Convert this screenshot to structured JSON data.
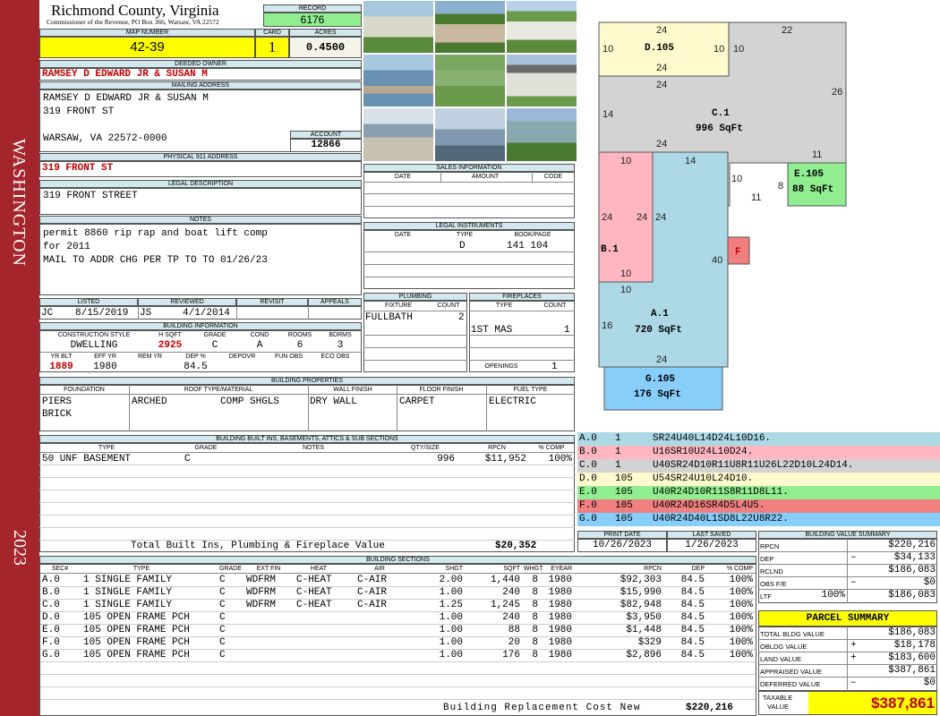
{
  "sidebar": {
    "district": "WASHINGTON",
    "year": "2023"
  },
  "header": {
    "county": "Richmond County, Virginia",
    "commissioner": "Commissioner of the Revenue, PO Box 366, Warsaw, VA 22572",
    "record_label": "RECORD",
    "record": "6176",
    "map_label": "MAP NUMBER",
    "map_number": "42-39",
    "card_label": "CARD",
    "card": "1",
    "acres_label": "ACRES",
    "acres": "0.4500"
  },
  "owner": {
    "deeded_label": "DEEDED OWNER",
    "deeded": "RAMSEY D EDWARD JR & SUSAN M",
    "mailing_label": "MAILING ADDRESS",
    "mail1": "RAMSEY D EDWARD JR & SUSAN M",
    "mail2": "319 FRONT ST",
    "mail3": "WARSAW, VA 22572-0000",
    "account_label": "ACCOUNT",
    "account": "12866",
    "physical_label": "PHYSICAL 911 ADDRESS",
    "physical": "319 FRONT ST",
    "legal_label": "LEGAL DESCRIPTION",
    "legal": "319 FRONT STREET",
    "notes_label": "NOTES",
    "notes1": "permit 8860 rip rap and boat lift comp",
    "notes2": "for 2011",
    "notes3": "MAIL TO ADDR CHG PER TP TO TO 01/26/23"
  },
  "review": {
    "listed_label": "LISTED",
    "reviewed_label": "REVIEWED",
    "revisit_label": "REVISIT",
    "appeals_label": "APPEALS",
    "listed_by": "JC",
    "listed_date": "8/15/2019",
    "reviewed_by": "JS",
    "reviewed_date": "4/1/2014"
  },
  "building_info": {
    "label": "BUILDING INFORMATION",
    "h_style": "CONSTRUCTION STYLE",
    "h_hsqft": "H SQFT",
    "h_grade": "GRADE",
    "h_cond": "COND",
    "h_rooms": "ROOMS",
    "h_bdrms": "BDRMS",
    "style": "DWELLING",
    "hsqft": "2925",
    "grade": "C",
    "cond": "A",
    "rooms": "6",
    "bdrms": "3",
    "h_yrblt": "YR BLT",
    "h_effyr": "EFF YR",
    "h_remyr": "REM YR",
    "h_dep": "DEP %",
    "h_depovr": "DEPOVR",
    "h_funobs": "FUN OBS",
    "h_ecoobs": "ECO OBS",
    "yrblt": "1889",
    "effyr": "1980",
    "dep": "84.5"
  },
  "sales": {
    "label": "SALES INFORMATION",
    "date": "DATE",
    "amount": "AMOUNT",
    "code": "CODE"
  },
  "legal_inst": {
    "label": "LEGAL INSTRUMENTS",
    "date": "DATE",
    "type": "TYPE",
    "bookpage": "BOOK/PAGE",
    "row_type": "D",
    "row_book": "141 104"
  },
  "plumbing": {
    "label": "PLUMBING",
    "fixture": "FIXTURE",
    "count": "COUNT",
    "row_fixture": "FULLBATH",
    "row_count": "2"
  },
  "fireplaces": {
    "label": "FIREPLACES",
    "type": "TYPE",
    "count": "COUNT",
    "row_type": "1ST MAS",
    "row_count": "1",
    "openings_label": "OPENINGS",
    "openings": "1"
  },
  "properties": {
    "label": "BUILDING PROPERTIES",
    "foundation_label": "FOUNDATION",
    "roof_label": "ROOF TYPE/MATERIAL",
    "wall_label": "WALL FINISH",
    "floor_label": "FLOOR FINISH",
    "fuel_label": "FUEL TYPE",
    "foundation1": "PIERS",
    "foundation2": "BRICK",
    "roof1": "ARCHED",
    "roof2": "COMP SHGLS",
    "wall": "DRY WALL",
    "floor": "CARPET",
    "fuel": "ELECTRIC"
  },
  "builtins": {
    "label": "BUILDING BUILT INS, BASEMENTS, ATTICS & SUB SECTIONS",
    "h_type": "TYPE",
    "h_grade": "GRADE",
    "h_notes": "NOTES",
    "h_qty": "QTY/SIZE",
    "h_rpcn": "RPCN",
    "h_comp": "% COMP",
    "row_type": "50 UNF BASEMENT",
    "row_grade": "C",
    "row_qty": "996",
    "row_rpcn": "$11,952",
    "row_comp": "100%",
    "total_label": "Total Built Ins, Plumbing & Fireplace Value",
    "total": "$20,352"
  },
  "sketch_labels": {
    "d105_name": "D.105",
    "c1_name": "C.1",
    "c1_area": "996 SqFt",
    "e105_name": "E.105",
    "e105_area": "88 SqFt",
    "b1_name": "B.1",
    "f_name": "F",
    "a1_name": "A.1",
    "a1_area": "720 SqFt",
    "g105_name": "G.105",
    "g105_area": "176 SqFt",
    "dims": [
      "24",
      "10",
      "10",
      "10",
      "22",
      "24",
      "24",
      "26",
      "14",
      "24",
      "11",
      "10",
      "14",
      "10",
      "8",
      "11",
      "24",
      "24",
      "24",
      "40",
      "10",
      "10",
      "16",
      "24"
    ]
  },
  "legend": [
    {
      "code": "A.0",
      "num": "1",
      "path": "SR24U40L14D24L10D16.",
      "color": "#add8e6"
    },
    {
      "code": "B.0",
      "num": "1",
      "path": "U16SR10U24L10D24.",
      "color": "#ffb6c1"
    },
    {
      "code": "C.0",
      "num": "1",
      "path": "U40SR24D10R11U8R11U26L22D10L24D14.",
      "color": "#d3d3d3"
    },
    {
      "code": "D.0",
      "num": "105",
      "path": "U54SR24U10L24D10.",
      "color": "#fffacd"
    },
    {
      "code": "E.0",
      "num": "105",
      "path": "U40R24D10R11S8R11D8L11.",
      "color": "#90ee90"
    },
    {
      "code": "F.0",
      "num": "105",
      "path": "U40R24D16SR4D5L4U5.",
      "color": "#f08080"
    },
    {
      "code": "G.0",
      "num": "105",
      "path": "U40R24D40L1SD8L22U8R22.",
      "color": "#87cefa"
    }
  ],
  "dates": {
    "print_label": "PRINT DATE",
    "saved_label": "LAST SAVED",
    "print": "10/26/2023",
    "saved": "1/26/2023"
  },
  "sections": {
    "label": "BUILDING SECTIONS",
    "h": [
      "SEC#",
      "TYPE",
      "GRADE",
      "EXT FIN",
      "HEAT",
      "AIR",
      "SHGT",
      "SQFT",
      "WHGT",
      "EYEAR",
      "RPCN",
      "DEP",
      "% COMP"
    ],
    "rows": [
      [
        "A.0",
        "1 SINGLE FAMILY",
        "C",
        "WDFRM",
        "C-HEAT",
        "C-AIR",
        "2.00",
        "1,440",
        "8",
        "1980",
        "$92,303",
        "84.5",
        "100%"
      ],
      [
        "B.0",
        "1 SINGLE FAMILY",
        "C",
        "WDFRM",
        "C-HEAT",
        "C-AIR",
        "1.00",
        "240",
        "8",
        "1980",
        "$15,990",
        "84.5",
        "100%"
      ],
      [
        "C.0",
        "1 SINGLE FAMILY",
        "C",
        "WDFRM",
        "C-HEAT",
        "C-AIR",
        "1.25",
        "1,245",
        "8",
        "1980",
        "$82,948",
        "84.5",
        "100%"
      ],
      [
        "D.0",
        "105 OPEN FRAME PCH",
        "C",
        "",
        "",
        "",
        "1.00",
        "240",
        "8",
        "1980",
        "$3,950",
        "84.5",
        "100%"
      ],
      [
        "E.0",
        "105 OPEN FRAME PCH",
        "C",
        "",
        "",
        "",
        "1.00",
        "88",
        "8",
        "1980",
        "$1,448",
        "84.5",
        "100%"
      ],
      [
        "F.0",
        "105 OPEN FRAME PCH",
        "C",
        "",
        "",
        "",
        "1.00",
        "20",
        "8",
        "1980",
        "$329",
        "84.5",
        "100%"
      ],
      [
        "G.0",
        "105 OPEN FRAME PCH",
        "C",
        "",
        "",
        "",
        "1.00",
        "176",
        "8",
        "1980",
        "$2,896",
        "84.5",
        "100%"
      ]
    ],
    "rcn_label": "Building Replacement Cost New",
    "rcn": "$220,216"
  },
  "bvs": {
    "label": "BUILDING VALUE SUMMARY",
    "rpcn_l": "RPCN",
    "rpcn": "$220,216",
    "dep_l": "DEP",
    "dep_s": "–",
    "dep": "$34,133",
    "rclnd_l": "RCLND",
    "rclnd": "$186,083",
    "obs_l": "OBS F/E",
    "obs_s": "–",
    "obs": "$0",
    "ltf_l": "LTF",
    "ltf_pct": "100%",
    "ltf": "$186,083"
  },
  "parcel": {
    "label": "PARCEL SUMMARY",
    "tbv_l": "TOTAL BLDG VALUE",
    "tbv": "$186,083",
    "obv_l": "OBLDG VALUE",
    "obv_s": "+",
    "obv": "$18,178",
    "land_l": "LAND VALUE",
    "land_s": "+",
    "land": "$183,600",
    "appr_l": "APPRAISED VALUE",
    "appr": "$387,861",
    "def_l": "DEFERRED VALUE",
    "def_s": "–",
    "def": "$0",
    "tax_l1": "TAXABLE",
    "tax_l2": "VALUE",
    "tax": "$387,861"
  },
  "colors": {
    "sidebar": "#a4262c",
    "header_blue": "#d2e8ee",
    "record_green": "#90ee90",
    "highlight_yellow": "#ffff00",
    "accent_red": "#c00000"
  }
}
